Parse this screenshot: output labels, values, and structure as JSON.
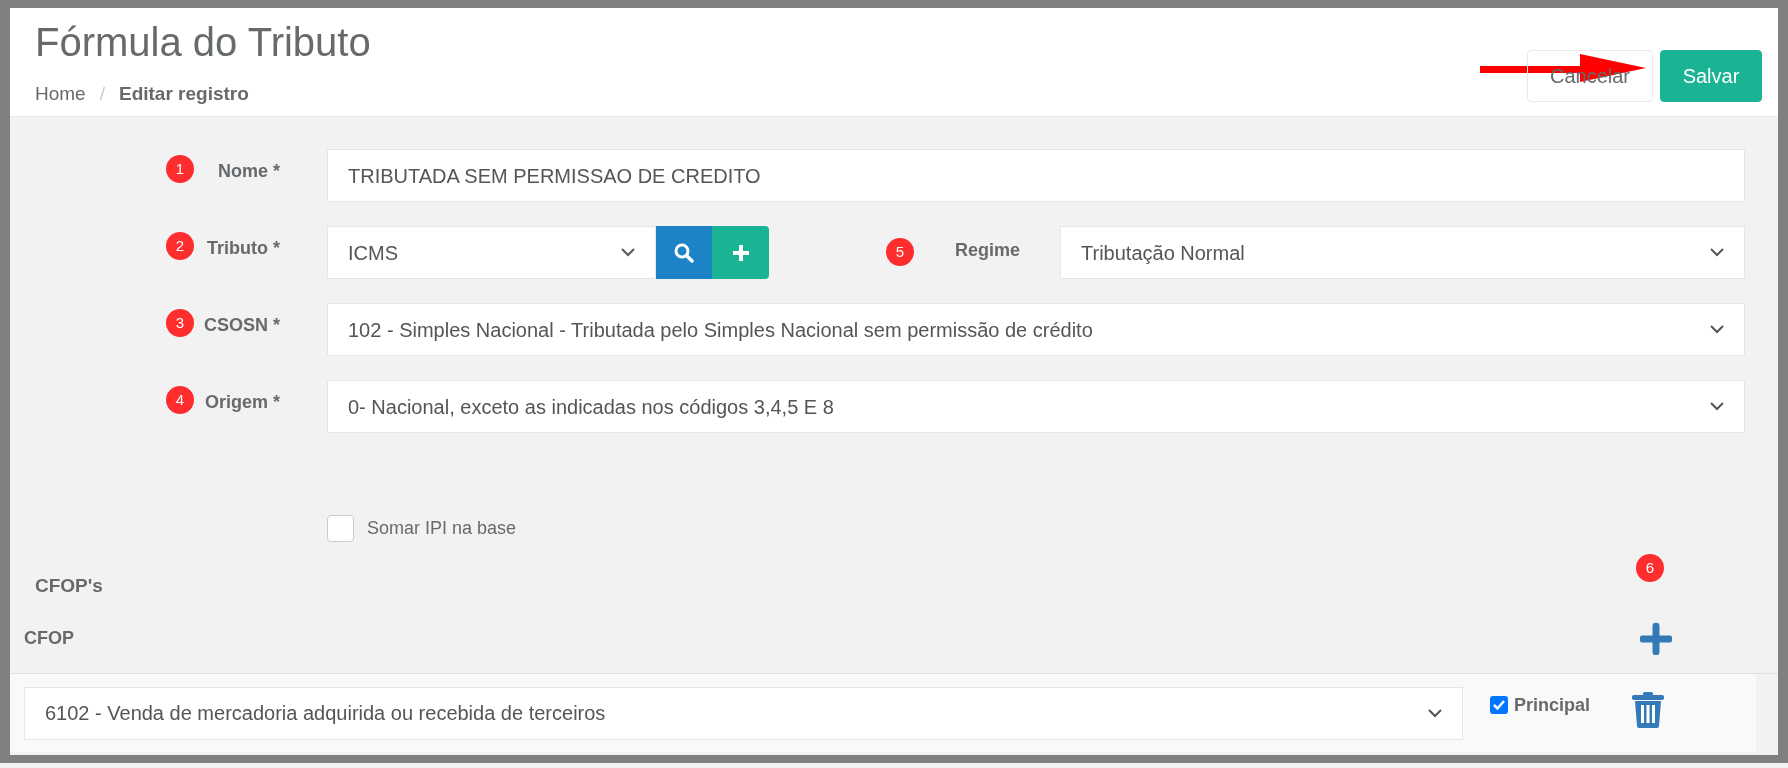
{
  "page": {
    "title": "Fórmula do Tributo",
    "breadcrumb": [
      {
        "label": "Home",
        "current": false
      },
      {
        "label": "Editar registro",
        "current": true
      }
    ],
    "breadcrumb_separator": "/"
  },
  "actions": [
    {
      "label": "Cancelar",
      "kind": "default"
    },
    {
      "label": "Salvar",
      "kind": "primary"
    }
  ],
  "fields": [
    {
      "kind": "text",
      "label": "Nome *",
      "value": "TRIBUTADA SEM PERMISSAO DE CREDITO",
      "badge": "1"
    },
    {
      "kind": "lookup",
      "label": "Tributo *",
      "value": "ICMS",
      "badge": "2",
      "side": {
        "label": "Regime",
        "value": "Tributação Normal",
        "badge": "5"
      }
    },
    {
      "kind": "select",
      "label": "CSOSN *",
      "value": "102 - Simples Nacional - Tributada pelo Simples Nacional sem permissão de crédito",
      "badge": "3"
    },
    {
      "kind": "select",
      "label": "Origem *",
      "value": "0- Nacional, exceto as indicadas nos códigos 3,4,5 E 8",
      "badge": "4"
    }
  ],
  "somar_ipi": {
    "label": "Somar IPI na base",
    "checked": false
  },
  "cfops": {
    "heading": "CFOP's",
    "badge": "6",
    "column": "CFOP",
    "rows": [
      {
        "value": "6102 - Venda de mercadoria adquirida ou recebida de terceiros",
        "principal_label": "Principal",
        "principal": true
      }
    ]
  }
}
